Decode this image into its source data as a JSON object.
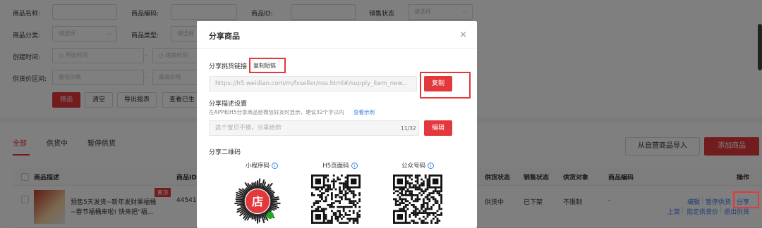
{
  "filters": {
    "row1": {
      "name_label": "商品名称:",
      "code_label": "商品编码:",
      "id_label": "商品ID:",
      "sale_status_label": "销售状态",
      "sale_status_placeholder": "请选择"
    },
    "row2": {
      "category_label": "商品分类:",
      "category_placeholder": "请选择",
      "type_label": "商品类型:",
      "type_placeholder": "请选择"
    },
    "row3": {
      "created_label": "创建时间:",
      "start_placeholder": "开始时间",
      "end_placeholder": "结束时间"
    },
    "row4": {
      "price_label": "供货价区间:",
      "min_placeholder": "最低价格",
      "max_placeholder": "最高价格"
    },
    "buttons": {
      "filter": "筛选",
      "clear": "清空",
      "export": "导出报表",
      "view": "查看已生"
    }
  },
  "tabs": [
    {
      "label": "全部"
    },
    {
      "label": "供货中"
    },
    {
      "label": "暂停供货"
    }
  ],
  "actions": {
    "import": "从自营商品导入",
    "add": "添加商品"
  },
  "table": {
    "headers": {
      "desc": "商品描述",
      "id": "商品ID",
      "supply_status": "供货状态",
      "sale_status": "销售状态",
      "target": "供货对象",
      "code": "商品编码",
      "ops": "操作"
    },
    "row": {
      "badge": "置顶",
      "title_line1": "预售5天发货~新年发财果福桶",
      "title_line2": "~春节福桶来啦! 快来把“福...",
      "id": "445412",
      "supply_status": "供货中",
      "sale_status": "已下架",
      "target": "不限制",
      "code": "-",
      "ops_line1": [
        "编辑",
        "暂停供货",
        "分享"
      ],
      "ops_line2": [
        "上架",
        "指定供货价",
        "退出供货"
      ]
    }
  },
  "modal": {
    "title": "分享商品",
    "close": "×",
    "link_label": "分享挑货链接",
    "copy_link": "复制短链",
    "link_value": "https://h5.weidian.com/m/fxseller/nss.html#/supply_item_new...",
    "copy_button": "复制",
    "desc_label": "分享描述设置",
    "desc_hint": "在APP和H5分享商品给微信好友时显示，建议32个字以内",
    "desc_example": "查看示例",
    "desc_placeholder": "这个宝贝不错，分享给你",
    "desc_count": "11/32",
    "edit_button": "编辑",
    "qr_label": "分享二维码",
    "qr_codes": [
      {
        "label": "小程序码",
        "info_icon": "i"
      },
      {
        "label": "H5页面码",
        "info_icon": "i"
      },
      {
        "label": "公众号码",
        "info_icon": "i"
      }
    ],
    "mini_logo_text": "店"
  },
  "colors": {
    "accent": "#e4393c",
    "link": "#3d7ce8",
    "overlay": "rgba(0,0,0,0.5)"
  }
}
